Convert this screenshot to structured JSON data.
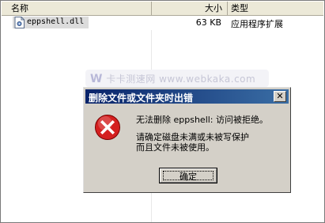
{
  "columns": {
    "name": "名称",
    "size": "大小",
    "type": "类型"
  },
  "file": {
    "name": "eppshell.dll",
    "size": "63 KB",
    "type": "应用程序扩展"
  },
  "watermark": {
    "logo": "W",
    "text": "卡卡测速网 www.webkaka.com"
  },
  "dialog": {
    "title": "删除文件或文件夹时出错",
    "close_glyph": "✕",
    "message_line1": "无法删除 eppshell: 访问被拒绝。",
    "message_line2": "请确定磁盘未满或未被写保护",
    "message_line3": "而且文件未被使用。",
    "ok_label": "确定"
  },
  "colors": {
    "titlebar_start": "#0a246a",
    "titlebar_end": "#3a6ea5",
    "dialog_bg": "#d4d0c8",
    "error_red": "#d42020"
  },
  "icons": [
    "file-dll-icon",
    "error-icon",
    "close-icon"
  ]
}
